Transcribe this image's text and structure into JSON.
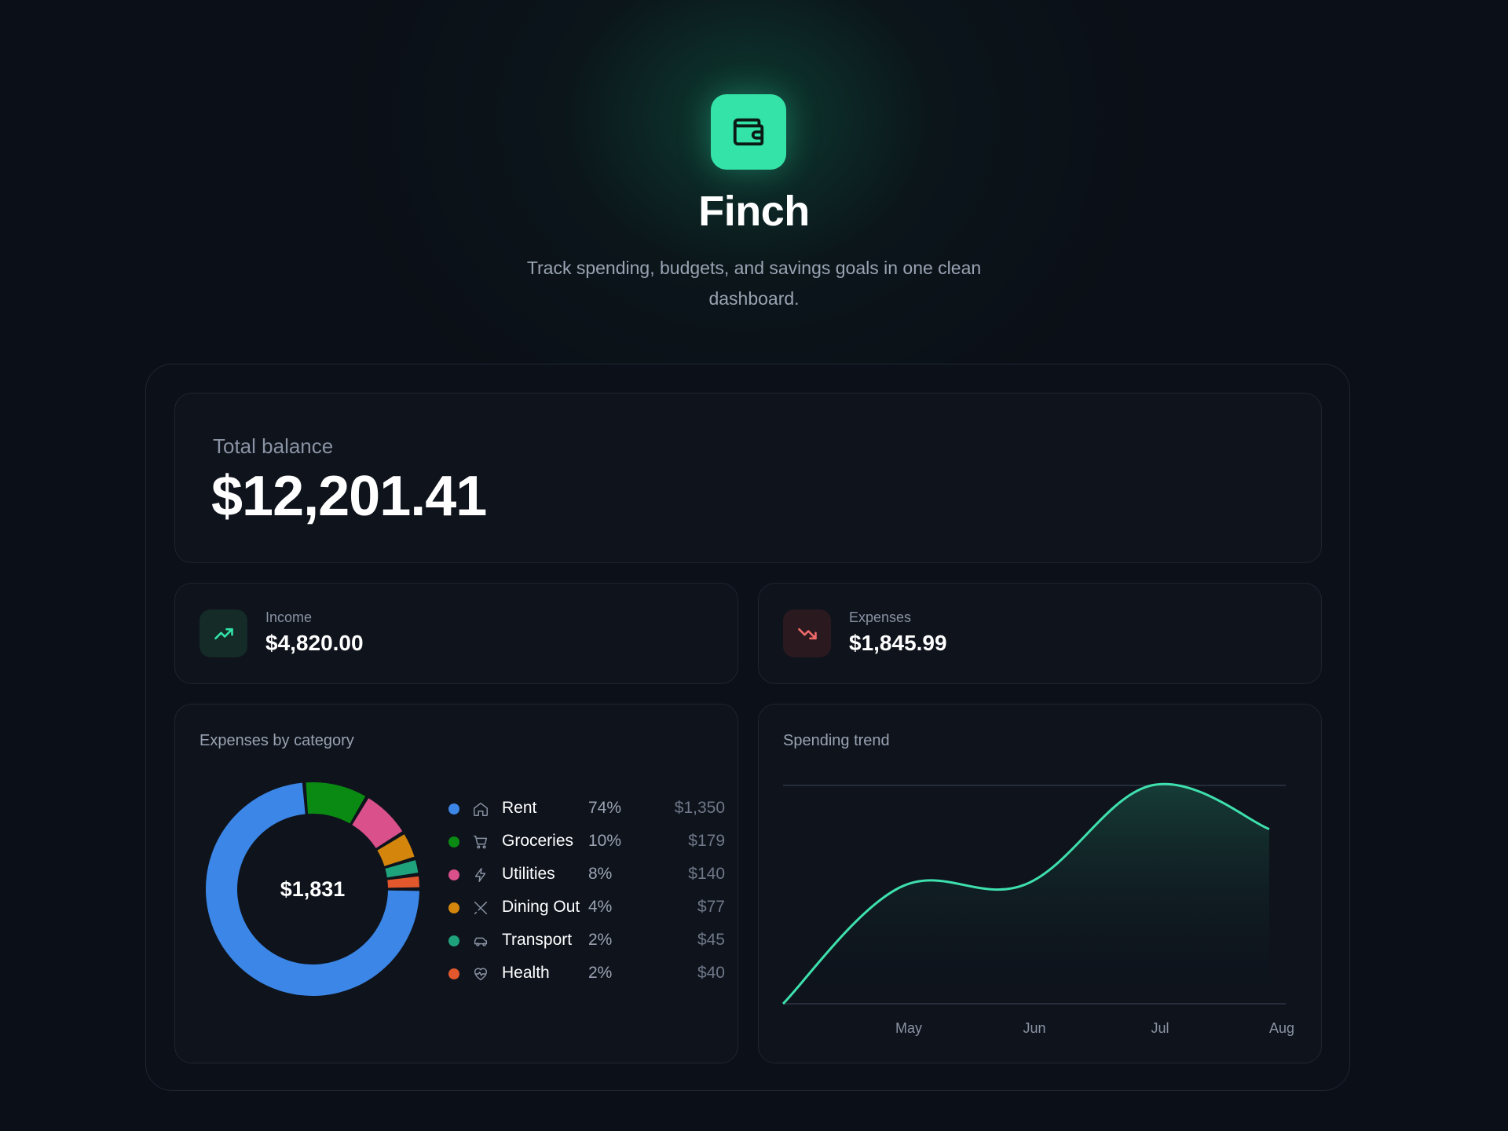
{
  "app": {
    "title": "Finch",
    "tagline": "Track spending, budgets, and savings goals in one clean dashboard.",
    "logo_icon": "wallet-icon",
    "accent": "#34e3a8"
  },
  "balance": {
    "label": "Total balance",
    "value": "$12,201.41"
  },
  "income": {
    "label": "Income",
    "value": "$4,820.00",
    "icon": "trending-up-icon",
    "color": "#34e3a8"
  },
  "expenses": {
    "label": "Expenses",
    "value": "$1,845.99",
    "icon": "trending-down-icon",
    "color": "#f06a6a"
  },
  "categories_panel": {
    "title": "Expenses by category",
    "total": "$1,831",
    "items": [
      {
        "name": "Rent",
        "pct": "74%",
        "amount": "$1,350",
        "color": "#3b86e6",
        "icon": "home-icon"
      },
      {
        "name": "Groceries",
        "pct": "10%",
        "amount": "$179",
        "color": "#0a8a12",
        "icon": "cart-icon"
      },
      {
        "name": "Utilities",
        "pct": "8%",
        "amount": "$140",
        "color": "#d9508a",
        "icon": "bolt-icon"
      },
      {
        "name": "Dining Out",
        "pct": "4%",
        "amount": "$77",
        "color": "#d4860c",
        "icon": "utensils-icon"
      },
      {
        "name": "Transport",
        "pct": "2%",
        "amount": "$45",
        "color": "#1fa37c",
        "icon": "car-icon"
      },
      {
        "name": "Health",
        "pct": "2%",
        "amount": "$40",
        "color": "#e2582c",
        "icon": "heart-pulse-icon"
      }
    ]
  },
  "chart_data": {
    "type": "area",
    "title": "Spending trend",
    "x": [
      "May",
      "Jun",
      "Jul",
      "Aug"
    ],
    "series": [
      {
        "values": [
          1180,
          1200,
          1845,
          1560
        ]
      }
    ],
    "start_value": 420,
    "ylim": [
      420,
      1845
    ],
    "grid": true,
    "line_color": "#3ee0ad"
  }
}
